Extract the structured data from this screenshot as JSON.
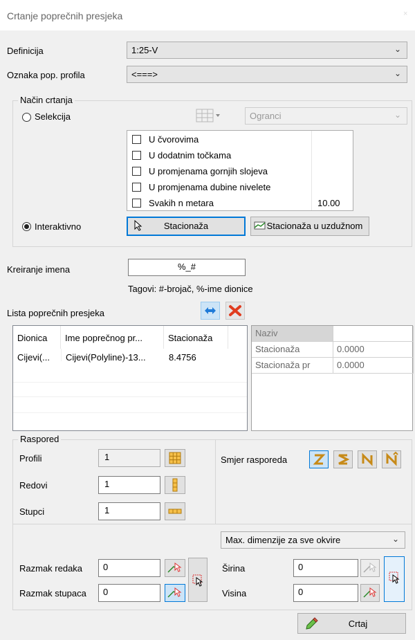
{
  "window": {
    "title": "Crtanje poprečnih presjeka",
    "close": "×"
  },
  "definicija": {
    "label": "Definicija",
    "value": "1:25-V"
  },
  "oznaka": {
    "label": "Oznaka pop. profila",
    "value": "<===>"
  },
  "nacin": {
    "group_label": "Način crtanja",
    "selekcija_label": "Selekcija",
    "selekcija_selected": false,
    "ogranci_value": "Ogranci",
    "options": [
      {
        "label": "U čvorovima",
        "checked": false,
        "value": ""
      },
      {
        "label": "U dodatnim točkama",
        "checked": false,
        "value": ""
      },
      {
        "label": "U promjenama gornjih slojeva",
        "checked": false,
        "value": ""
      },
      {
        "label": "U promjenama dubine nivelete",
        "checked": false,
        "value": ""
      },
      {
        "label": "Svakih n metara",
        "checked": false,
        "value": "10.00"
      }
    ],
    "interaktivno_label": "Interaktivno",
    "interaktivno_selected": true,
    "stacionaza_button": "Stacionaža",
    "stacionaza_uzduznom_button": "Stacionaža u uzdužnom"
  },
  "kreiranje": {
    "label": "Kreiranje imena",
    "value": "%_#",
    "tags": "Tagovi: #-brojač, %-ime dionice"
  },
  "lista": {
    "label": "Lista poprečnih presjeka",
    "columns": [
      "Dionica",
      "Ime poprečnog pr...",
      "Stacionaža"
    ],
    "rows": [
      [
        "Cijevi(...",
        "Cijevi(Polyline)-13...",
        "8.4756"
      ]
    ]
  },
  "properties": {
    "header": "Naziv",
    "rows": [
      {
        "name": "Stacionaža",
        "value": "0.0000"
      },
      {
        "name": "Stacionaža pr",
        "value": "0.0000"
      }
    ]
  },
  "raspored": {
    "group_label": "Raspored",
    "profili_label": "Profili",
    "profili_value": "1",
    "redovi_label": "Redovi",
    "redovi_value": "1",
    "stupci_label": "Stupci",
    "stupci_value": "1",
    "smjer_label": "Smjer rasporeda"
  },
  "razmak": {
    "redaka_label": "Razmak redaka",
    "redaka_value": "0",
    "stupaca_label": "Razmak stupaca",
    "stupaca_value": "0",
    "dimenzije_value": "Max. dimenzije za sve okvire",
    "sirina_label": "Širina",
    "sirina_value": "0",
    "visina_label": "Visina",
    "visina_value": "0"
  },
  "crtaj_button": "Crtaj",
  "colors": {
    "accent": "#0078d7",
    "delete_red": "#e03c1f",
    "icon_gold": "#e8b04a"
  }
}
